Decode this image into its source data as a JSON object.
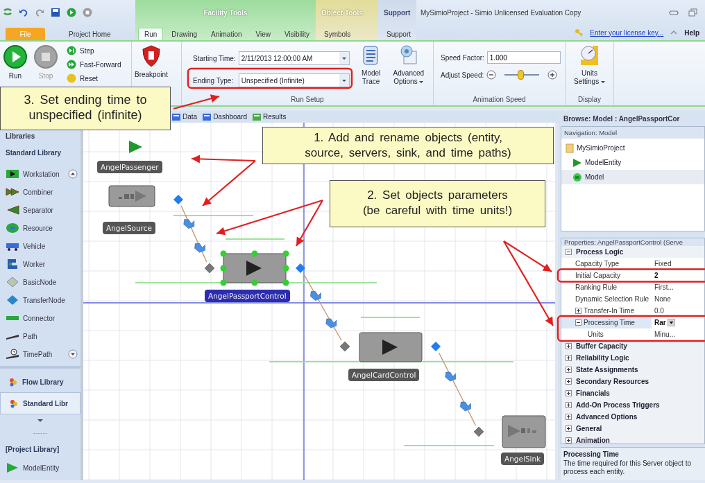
{
  "window": {
    "title": "MySimioProject - Simio Unlicensed Evaluation Copy"
  },
  "tab_groups": [
    {
      "kind": "plain",
      "tabs": [
        {
          "label": "File",
          "kind": "file",
          "selected": false
        },
        {
          "label": "Project Home",
          "kind": "tab",
          "selected": false
        }
      ]
    },
    {
      "kind": "facility",
      "label": "Facility Tools",
      "tabs": [
        {
          "label": "Run",
          "kind": "tab",
          "selected": true
        },
        {
          "label": "Drawing",
          "kind": "tab",
          "selected": false
        },
        {
          "label": "Animation",
          "kind": "tab",
          "selected": false
        },
        {
          "label": "View",
          "kind": "tab",
          "selected": false
        },
        {
          "label": "Visibility",
          "kind": "tab",
          "selected": false
        }
      ]
    },
    {
      "kind": "object",
      "label": "Object Tools",
      "tabs": [
        {
          "label": "Symbols",
          "kind": "tab",
          "selected": false
        }
      ]
    },
    {
      "kind": "support",
      "label": "Support",
      "tabs": [
        {
          "label": "Support",
          "kind": "tab",
          "selected": false
        }
      ]
    }
  ],
  "license_link": "Enter your license key...",
  "help": "Help",
  "ribbon": {
    "run": {
      "label": "Run",
      "disabled": false
    },
    "stop": {
      "label": "Stop",
      "disabled": true
    },
    "small_buttons": [
      {
        "label": "Step",
        "kind": "step"
      },
      {
        "label": "Fast-Forward",
        "kind": "fast"
      },
      {
        "label": "Reset",
        "kind": "reset"
      }
    ],
    "breakpoint": "Breakpoint",
    "starting_time": {
      "label": "Starting Time:",
      "value": "2/11/2013 12:00:00 AM"
    },
    "ending_type": {
      "label": "Ending Type:",
      "value": "Unspecified (Infinite)"
    },
    "model_trace": "Model Trace",
    "advanced_options": "Advanced Options",
    "run_setup": "Run Setup",
    "speed_factor": {
      "label": "Speed Factor:",
      "value": "1.000"
    },
    "adjust_speed": {
      "label": "Adjust Speed:",
      "level": 0.45
    },
    "animation_speed": "Animation Speed",
    "units_settings": "Units Settings",
    "display": "Display"
  },
  "canvas_tabs": [
    "Data",
    "Dashboard",
    "Results"
  ],
  "libraries": {
    "title": "Libraries",
    "section": "Standard Library",
    "items": [
      {
        "label": "Workstation",
        "kind": "workstation"
      },
      {
        "label": "Combiner",
        "kind": "combiner"
      },
      {
        "label": "Separator",
        "kind": "separator"
      },
      {
        "label": "Resource",
        "kind": "resource"
      },
      {
        "label": "Vehicle",
        "kind": "vehicle"
      },
      {
        "label": "Worker",
        "kind": "worker"
      },
      {
        "label": "BasicNode",
        "kind": "basicnode"
      },
      {
        "label": "TransferNode",
        "kind": "transfernode"
      },
      {
        "label": "Connector",
        "kind": "connector"
      },
      {
        "label": "Path",
        "kind": "path"
      },
      {
        "label": "TimePath",
        "kind": "timepath"
      }
    ],
    "libraries": [
      {
        "label": "Flow Library",
        "selected": false
      },
      {
        "label": "Standard Libr",
        "selected": true
      }
    ],
    "project_library": "[Project Library]",
    "project_items": [
      "ModelEntity"
    ]
  },
  "objects": [
    {
      "kind": "entity",
      "label": "AngelPassenger",
      "selected": false
    },
    {
      "kind": "source",
      "label": "AngelSource",
      "selected": false
    },
    {
      "kind": "server",
      "label": "AngelPassportControl",
      "selected": true
    },
    {
      "kind": "server",
      "label": "AngelCardControl",
      "selected": false
    },
    {
      "kind": "sink",
      "label": "AngelSink",
      "selected": false
    }
  ],
  "right_panel": {
    "browse_title": "Browse: Model : AngelPassportCor",
    "navigation_title": "Navigation: Model",
    "tree": [
      {
        "label": "MySimioProject",
        "kind": "folder",
        "selected": false,
        "children": [
          {
            "label": "ModelEntity",
            "kind": "entity",
            "selected": false
          },
          {
            "label": "Model",
            "kind": "model",
            "selected": true
          }
        ]
      }
    ],
    "properties_title": "Properties: AngelPassportControl (Serve",
    "properties": [
      {
        "label": "Process Logic",
        "expanded": true,
        "rows": [
          {
            "label": "Capacity Type",
            "value": "Fixed",
            "kind": "text",
            "changed": false,
            "selected": false
          },
          {
            "label": "Initial Capacity",
            "value": "2",
            "kind": "text",
            "changed": true,
            "selected": false
          },
          {
            "label": "Ranking Rule",
            "value": "First...",
            "kind": "text",
            "changed": false,
            "selected": false
          },
          {
            "label": "Dynamic Selection Rule",
            "value": "None",
            "kind": "text",
            "changed": false,
            "selected": false
          },
          {
            "label": "Transfer-In Time",
            "value": "0.0",
            "kind": "text",
            "changed": false,
            "selected": false,
            "expanded": false
          },
          {
            "label": "Processing Time",
            "value": "Rar",
            "kind": "dropdown",
            "changed": true,
            "selected": true,
            "expanded": true,
            "children": [
              {
                "label": "Units",
                "value": "Minu...",
                "changed": false,
                "selected": false
              }
            ]
          }
        ]
      },
      {
        "label": "Buffer Capacity",
        "expanded": false
      },
      {
        "label": "Reliability Logic",
        "expanded": false
      },
      {
        "label": "State Assignments",
        "expanded": false
      },
      {
        "label": "Secondary Resources",
        "expanded": false
      },
      {
        "label": "Financials",
        "expanded": false
      },
      {
        "label": "Add-On Process Triggers",
        "expanded": false
      },
      {
        "label": "Advanced Options",
        "expanded": false
      },
      {
        "label": "General",
        "expanded": false
      },
      {
        "label": "Animation",
        "expanded": false
      }
    ],
    "help": {
      "title": "Processing Time",
      "text": "The time required for this Server object to process each entity."
    }
  },
  "callouts": [
    {
      "lines": [
        "1. Add and rename objects (entity,",
        "source, servers, sink, and time paths)"
      ]
    },
    {
      "lines": [
        "2. Set objects parameters",
        "(be careful with time units!)"
      ]
    },
    {
      "lines": [
        "3. Set ending time to",
        "unspecified  (infinite)"
      ]
    }
  ]
}
